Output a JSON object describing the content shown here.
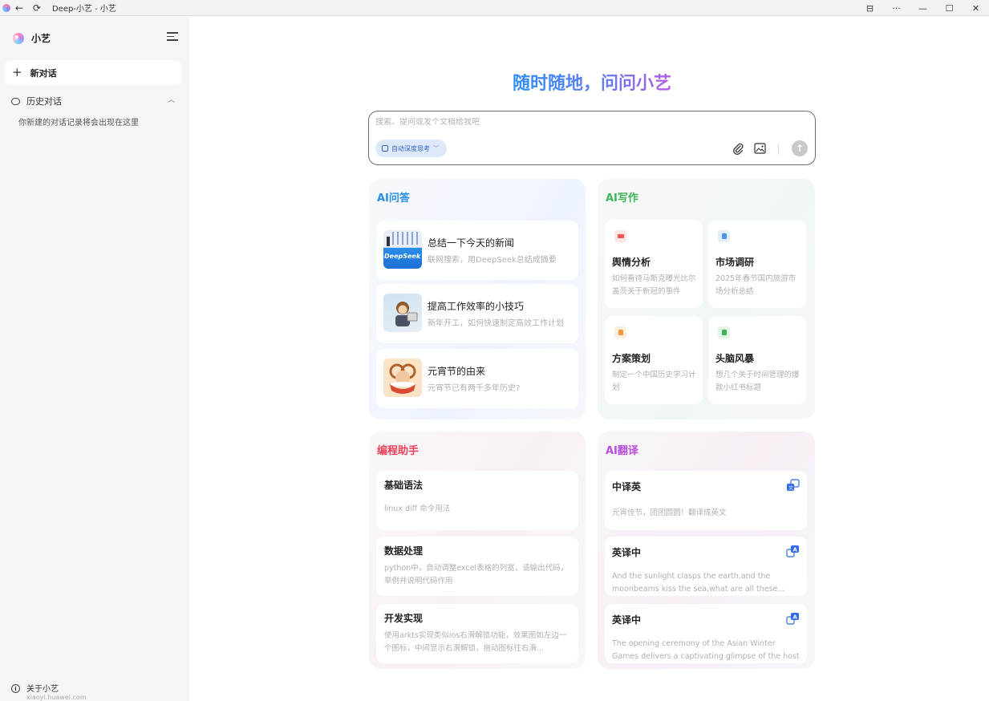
{
  "window": {
    "title": "Deep-小艺 - 小艺",
    "controls": [
      "⊟",
      "···",
      "—",
      "☐",
      "✕"
    ]
  },
  "sidebar": {
    "brand": "小艺",
    "new_chat": "新对话",
    "history": "历史对话",
    "history_empty": "你新建的对话记录将会出现在这里",
    "about": "关于小艺",
    "about_url": "xiaoyi.huawei.com"
  },
  "main": {
    "headline": "随时随地，问问小艺",
    "search": {
      "placeholder": "搜索、提问或发个文档给我吧",
      "chip": "自动深度思考"
    }
  },
  "panels": {
    "qa": {
      "title": "AI问答",
      "color": "#2a8ee8",
      "items": [
        {
          "title": "总结一下今天的新闻",
          "desc": "联网搜索，用DeepSeek总结成摘要",
          "thumb_text": "DeepSeek"
        },
        {
          "title": "提高工作效率的小技巧",
          "desc": "新年开工，如何快速制定高效工作计划"
        },
        {
          "title": "元宵节的由来",
          "desc": "元宵节已有两千多年历史?"
        }
      ]
    },
    "writing": {
      "title": "AI写作",
      "color": "#3bb558",
      "items": [
        {
          "title": "舆情分析",
          "desc": "如何看待马斯克曝光比尔盖茨关于新冠的事件",
          "icon_color": "#f0564f"
        },
        {
          "title": "市场调研",
          "desc": "2025年春节国内旅游市场分析总结",
          "icon_color": "#4a97e8"
        },
        {
          "title": "方案策划",
          "desc": "制定一个中国历史学习计划",
          "icon_color": "#f29a38"
        },
        {
          "title": "头脑风暴",
          "desc": "想几个关于时间管理的爆款小红书标题",
          "icon_color": "#3bb558"
        }
      ]
    },
    "coding": {
      "title": "编程助手",
      "color": "#e8405a",
      "items": [
        {
          "title": "基础语法",
          "desc": "linux diff 命令用法"
        },
        {
          "title": "数据处理",
          "desc": "python中，自动调整excel表格的列宽，请输出代码，举例并说明代码作用"
        },
        {
          "title": "开发实现",
          "desc": "使用arkts实现类似ios右滑解锁功能，效果图如左边一个图标，中间显示右滑解锁，拖动图标往右滑..."
        }
      ]
    },
    "translation": {
      "title": "AI翻译",
      "color": "#b94fdc",
      "items": [
        {
          "title": "中译英",
          "desc": "元宵佳节，团团圆圆！翻译成英文"
        },
        {
          "title": "英译中",
          "desc": "And the sunlight clasps the earth,and the moonbeams kiss the sea,what are all these..."
        },
        {
          "title": "英译中",
          "desc": "The opening ceremony of the Asian Winter Games delivers a captivating glimpse of the host city's..."
        }
      ]
    }
  }
}
